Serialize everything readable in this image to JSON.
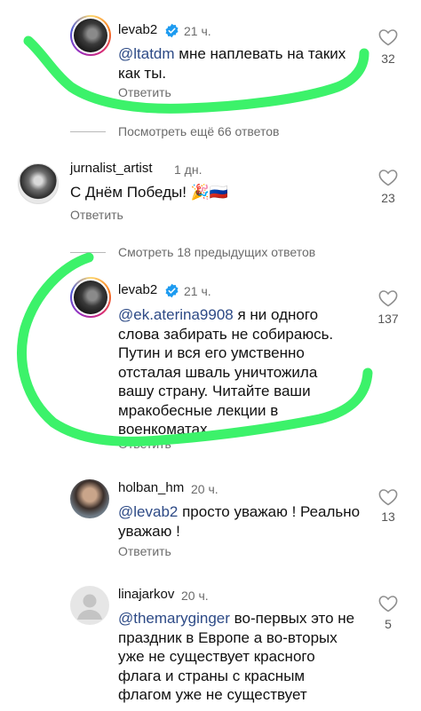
{
  "comments": [
    {
      "username": "levab2",
      "verified": true,
      "time": "21 ч.",
      "mention": "@ltatdm",
      "text_line1": " мне наплевать на таких",
      "text_line2": "как ты.",
      "reply": "Ответить",
      "likes": "32"
    },
    {
      "username": "jurnalist_artist",
      "verified": false,
      "time": "1 дн.",
      "text": "С Днём Победы! 🎉🇷🇺",
      "reply": "Ответить",
      "likes": "23"
    },
    {
      "username": "levab2",
      "verified": true,
      "time": "21 ч.",
      "mention": "@ek.aterina9908",
      "lines": [
        " я ни одного",
        "слова забирать не собираюсь.",
        "Путин и вся его умственно",
        "отсталая шваль уничтожила",
        "вашу страну.  Читайте ваши",
        "мракобесные лекции в",
        "военкоматах."
      ],
      "reply": "Ответить",
      "likes": "137"
    },
    {
      "username": "holban_hm",
      "verified": false,
      "time": "20 ч.",
      "mention": "@levab2",
      "text_line1": " просто уважаю ! Реально",
      "text_line2": "уважаю !",
      "reply": "Ответить",
      "likes": "13"
    },
    {
      "username": "linajarkov",
      "verified": false,
      "time": "20 ч.",
      "mention": "@themaryginger",
      "lines": [
        " во-первых это не",
        "праздник в Европе а во-вторых",
        "уже не существует красного",
        "флага и страны с красным",
        "флагом уже не существует"
      ],
      "likes": "5"
    }
  ],
  "view_more_replies": "Посмотреть ещё 66 ответов",
  "view_previous_replies": "Смотреть 18 предыдущих ответов",
  "colors": {
    "highlight_scribble": "#3cf26a",
    "mention": "#2d4a86",
    "verified": "#1d9bf0"
  },
  "icons": [
    "heart-icon",
    "verified-badge-icon",
    "avatar-icon"
  ]
}
